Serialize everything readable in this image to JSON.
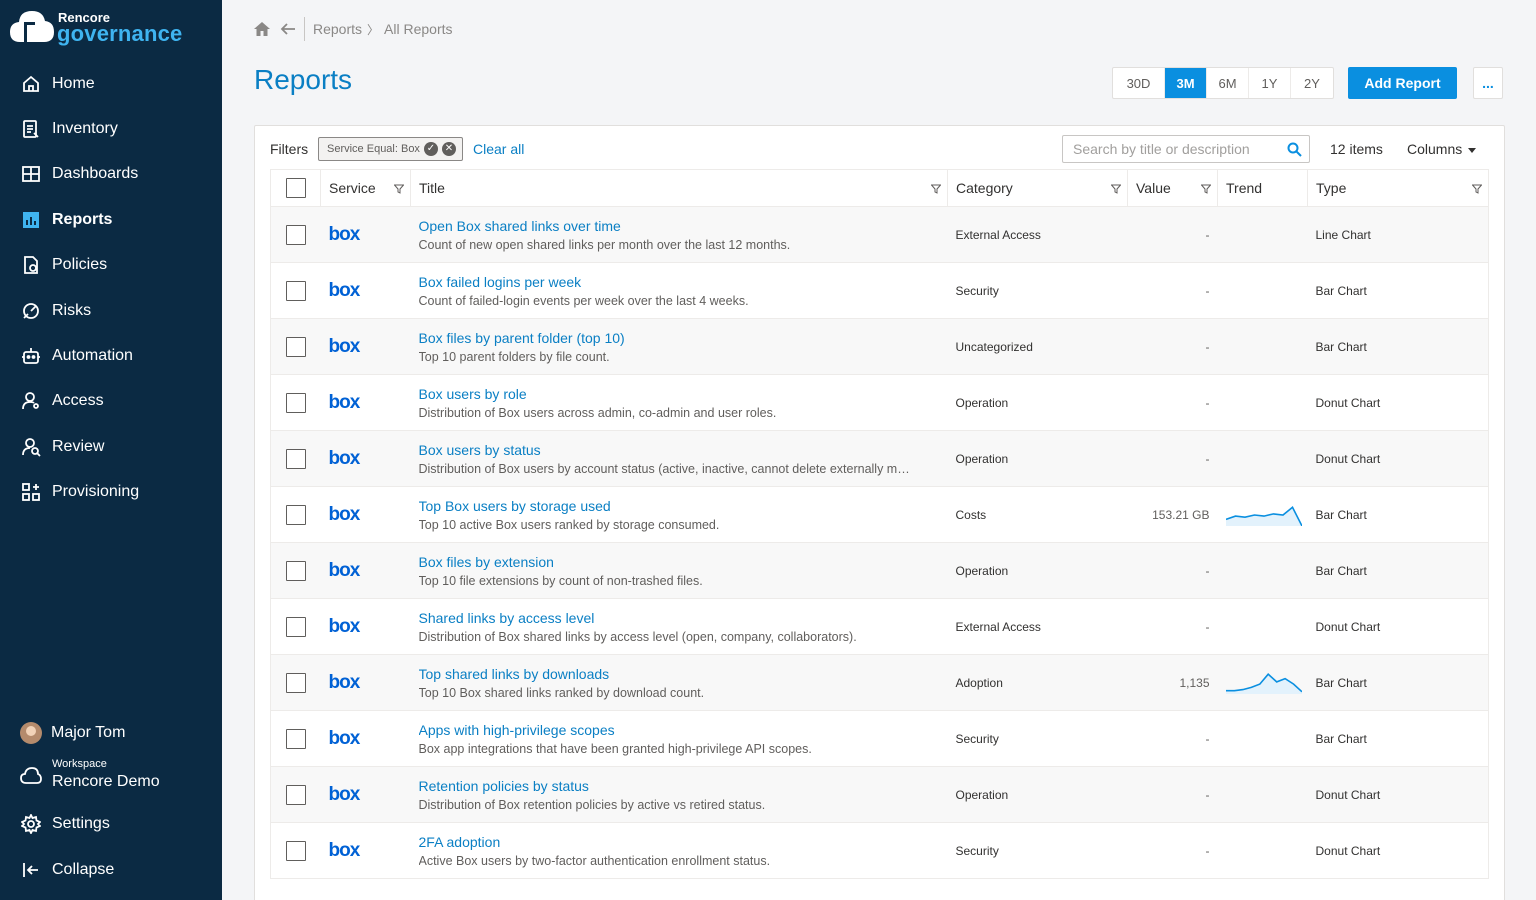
{
  "brand": {
    "top": "Rencore",
    "bottom": "governance"
  },
  "nav": [
    {
      "label": "Home",
      "icon": "home-icon"
    },
    {
      "label": "Inventory",
      "icon": "inventory-icon"
    },
    {
      "label": "Dashboards",
      "icon": "dashboards-icon"
    },
    {
      "label": "Reports",
      "icon": "reports-icon",
      "active": true
    },
    {
      "label": "Policies",
      "icon": "policies-icon"
    },
    {
      "label": "Risks",
      "icon": "risks-icon"
    },
    {
      "label": "Automation",
      "icon": "automation-icon"
    },
    {
      "label": "Access",
      "icon": "access-icon"
    },
    {
      "label": "Review",
      "icon": "review-icon"
    },
    {
      "label": "Provisioning",
      "icon": "provisioning-icon"
    }
  ],
  "user": {
    "name": "Major Tom"
  },
  "workspace": {
    "label": "Workspace",
    "name": "Rencore Demo"
  },
  "settings_label": "Settings",
  "collapse_label": "Collapse",
  "breadcrumb": {
    "parent": "Reports",
    "current": "All Reports"
  },
  "page_title": "Reports",
  "ranges": [
    "30D",
    "3M",
    "6M",
    "1Y",
    "2Y"
  ],
  "active_range": "3M",
  "add_report_label": "Add Report",
  "more_label": "...",
  "filters": {
    "label": "Filters",
    "chip": "Service Equal: Box",
    "clear_all": "Clear all"
  },
  "search": {
    "placeholder": "Search by title or description",
    "value": ""
  },
  "items_count": "12 items",
  "columns_label": "Columns",
  "table": {
    "headers": {
      "service": "Service",
      "title": "Title",
      "category": "Category",
      "value": "Value",
      "trend": "Trend",
      "type": "Type"
    },
    "rows": [
      {
        "service": "box",
        "title": "Open Box shared links over time",
        "desc": "Count of new open shared links per month over the last 12 months.",
        "category": "External Access",
        "value": "-",
        "trend": null,
        "type": "Line Chart"
      },
      {
        "service": "box",
        "title": "Box failed logins per week",
        "desc": "Count of failed-login events per week over the last 4 weeks.",
        "category": "Security",
        "value": "-",
        "trend": null,
        "type": "Bar Chart"
      },
      {
        "service": "box",
        "title": "Box files by parent folder (top 10)",
        "desc": "Top 10 parent folders by file count.",
        "category": "Uncategorized",
        "value": "-",
        "trend": null,
        "type": "Bar Chart"
      },
      {
        "service": "box",
        "title": "Box users by role",
        "desc": "Distribution of Box users across admin, co-admin and user roles.",
        "category": "Operation",
        "value": "-",
        "trend": null,
        "type": "Donut Chart"
      },
      {
        "service": "box",
        "title": "Box users by status",
        "desc": "Distribution of Box users by account status (active, inactive, cannot delete externally m…",
        "category": "Operation",
        "value": "-",
        "trend": null,
        "type": "Donut Chart"
      },
      {
        "service": "box",
        "title": "Top Box users by storage used",
        "desc": "Top 10 active Box users ranked by storage consumed.",
        "category": "Costs",
        "value": "153.21 GB",
        "trend": [
          0.3,
          0.45,
          0.4,
          0.5,
          0.45,
          0.55,
          0.5,
          0.85,
          0.0
        ],
        "type": "Bar Chart"
      },
      {
        "service": "box",
        "title": "Box files by extension",
        "desc": "Top 10 file extensions by count of non-trashed files.",
        "category": "Operation",
        "value": "-",
        "trend": null,
        "type": "Bar Chart"
      },
      {
        "service": "box",
        "title": "Shared links by access level",
        "desc": "Distribution of Box shared links by access level (open, company, collaborators).",
        "category": "External Access",
        "value": "-",
        "trend": null,
        "type": "Donut Chart"
      },
      {
        "service": "box",
        "title": "Top shared links by downloads",
        "desc": "Top 10 Box shared links ranked by download count.",
        "category": "Adoption",
        "value": "1,135",
        "trend": [
          0.15,
          0.15,
          0.2,
          0.3,
          0.45,
          0.9,
          0.55,
          0.7,
          0.45,
          0.1
        ],
        "type": "Bar Chart"
      },
      {
        "service": "box",
        "title": "Apps with high-privilege scopes",
        "desc": "Box app integrations that have been granted high-privilege API scopes.",
        "category": "Security",
        "value": "-",
        "trend": null,
        "type": "Bar Chart"
      },
      {
        "service": "box",
        "title": "Retention policies by status",
        "desc": "Distribution of Box retention policies by active vs retired status.",
        "category": "Operation",
        "value": "-",
        "trend": null,
        "type": "Donut Chart"
      },
      {
        "service": "box",
        "title": "2FA adoption",
        "desc": "Active Box users by two-factor authentication enrollment status.",
        "category": "Security",
        "value": "-",
        "trend": null,
        "type": "Donut Chart"
      }
    ]
  },
  "colors": {
    "sidebar": "#0b2a43",
    "accent": "#0a8fe0",
    "link": "#0a7fc4",
    "box_brand": "#0061d5"
  }
}
